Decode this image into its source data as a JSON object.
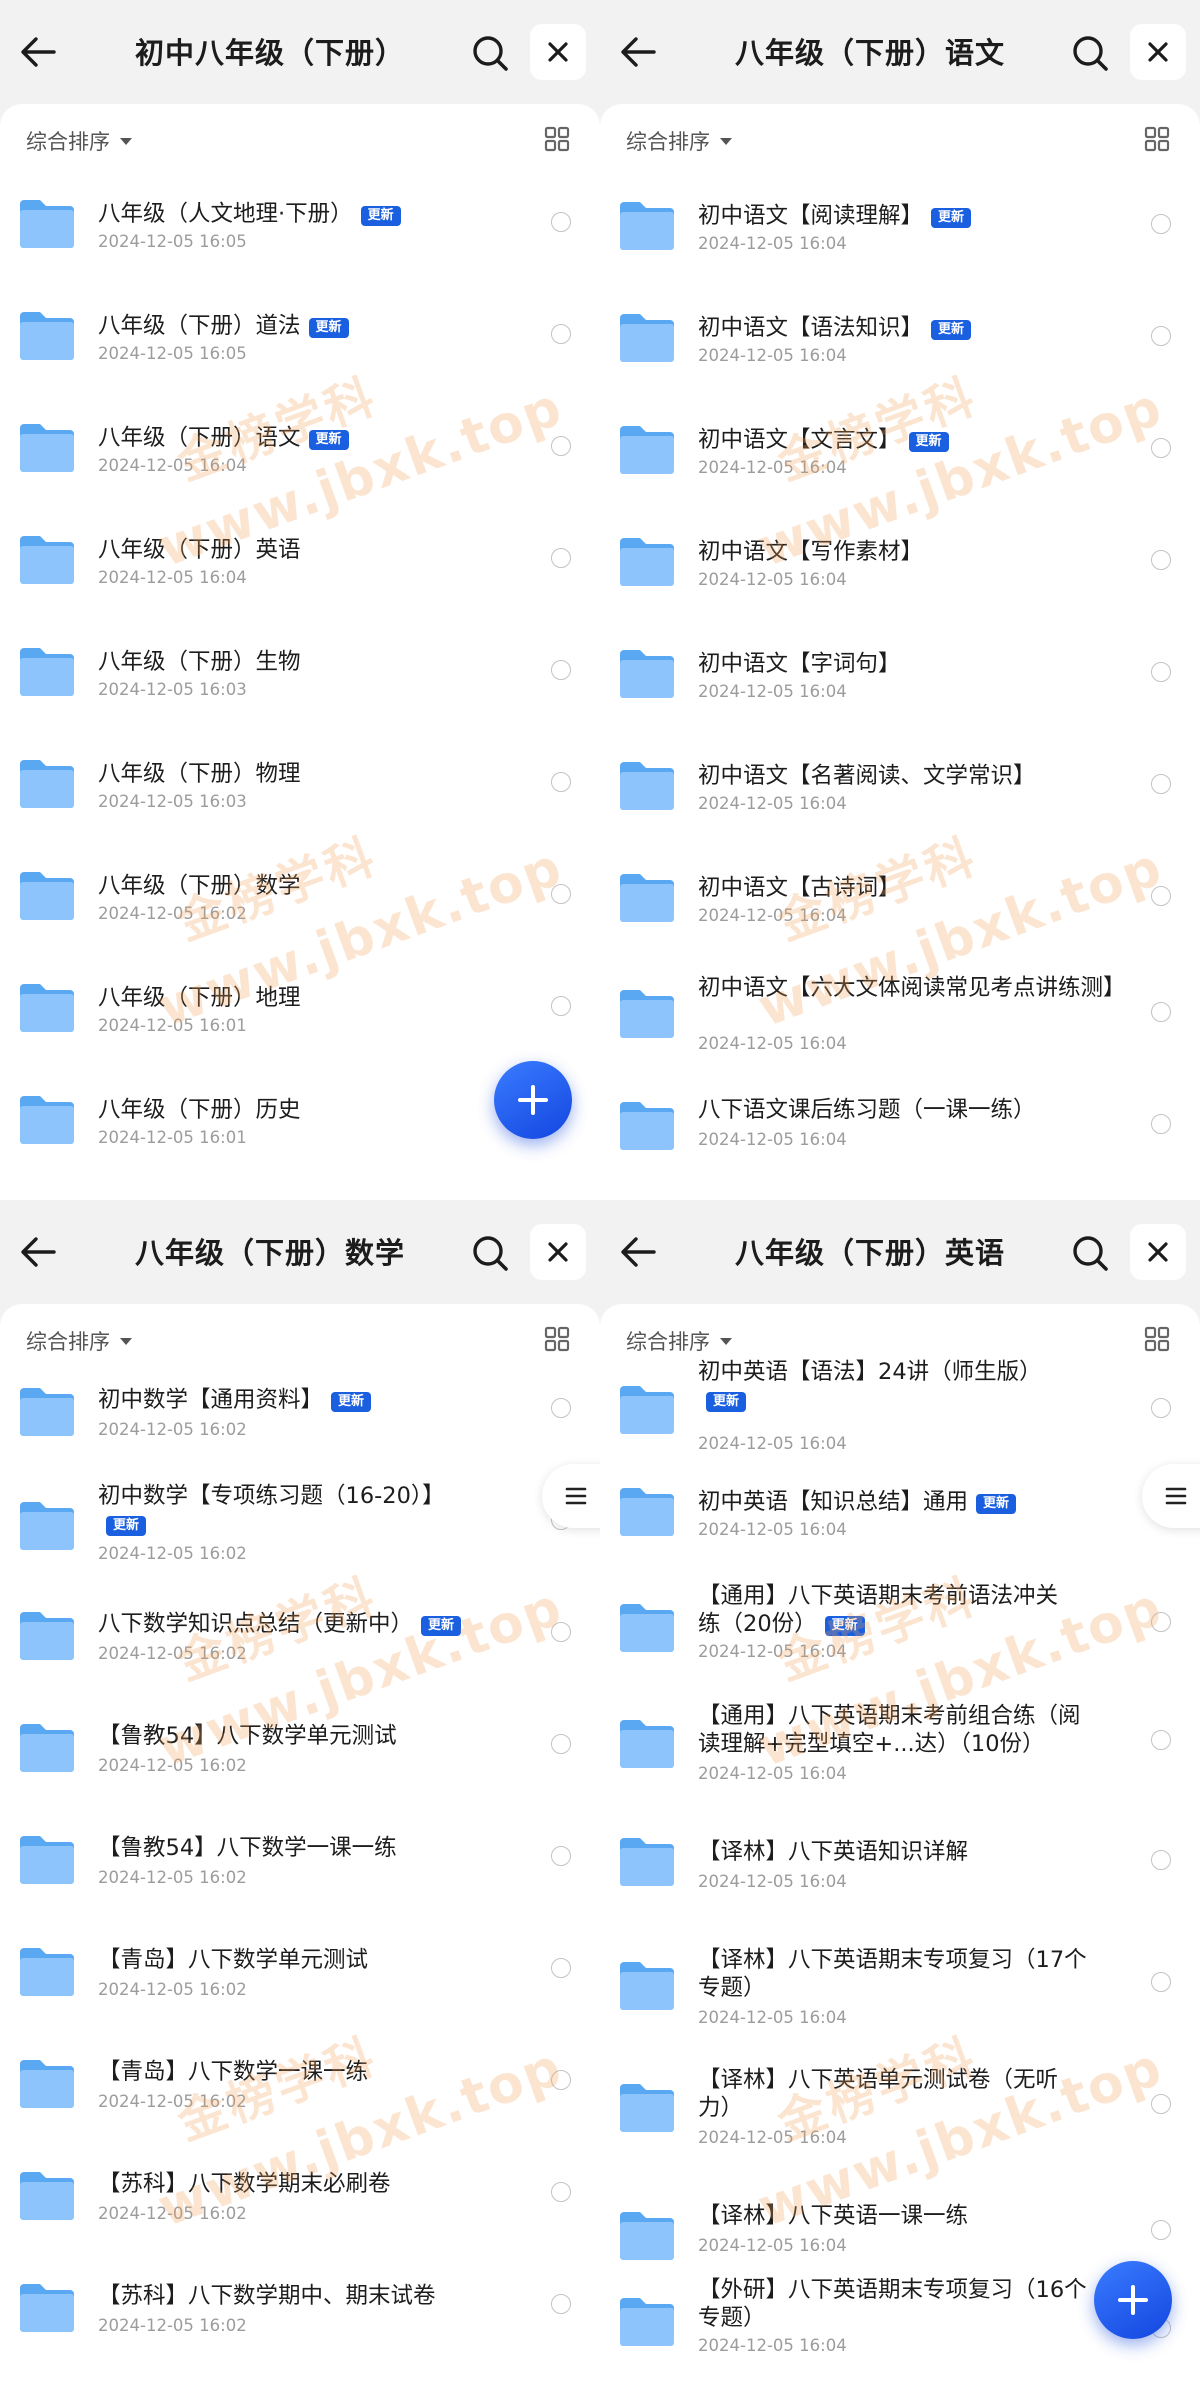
{
  "watermark": {
    "line1": "金榜学科",
    "line2": "www.jbxk.top"
  },
  "panels": [
    {
      "title": "初中八年级（下册）",
      "sort_label": "综合排序",
      "items": [
        {
          "name": "八年级（人文地理·下册）",
          "date": "2024-12-05 16:05",
          "badge": "更新"
        },
        {
          "name": "八年级（下册）道法",
          "date": "2024-12-05 16:05",
          "badge": "更新"
        },
        {
          "name": "八年级（下册）语文",
          "date": "2024-12-05 16:04",
          "badge": "更新"
        },
        {
          "name": "八年级（下册）英语",
          "date": "2024-12-05 16:04",
          "badge": ""
        },
        {
          "name": "八年级（下册）生物",
          "date": "2024-12-05 16:03",
          "badge": ""
        },
        {
          "name": "八年级（下册）物理",
          "date": "2024-12-05 16:03",
          "badge": ""
        },
        {
          "name": "八年级（下册）数学",
          "date": "2024-12-05 16:02",
          "badge": ""
        },
        {
          "name": "八年级（下册）地理",
          "date": "2024-12-05 16:01",
          "badge": ""
        },
        {
          "name": "八年级（下册）历史",
          "date": "2024-12-05 16:01",
          "badge": ""
        }
      ]
    },
    {
      "title": "八年级（下册）语文",
      "sort_label": "综合排序",
      "items": [
        {
          "name": "初中语文【阅读理解】",
          "date": "2024-12-05 16:04",
          "badge": "更新"
        },
        {
          "name": "初中语文【语法知识】",
          "date": "2024-12-05 16:04",
          "badge": "更新"
        },
        {
          "name": "初中语文【文言文】",
          "date": "2024-12-05 16:04",
          "badge": "更新"
        },
        {
          "name": "初中语文【写作素材】",
          "date": "2024-12-05 16:04",
          "badge": ""
        },
        {
          "name": "初中语文【字词句】",
          "date": "2024-12-05 16:04",
          "badge": ""
        },
        {
          "name": "初中语文【名著阅读、文学常识】",
          "date": "2024-12-05 16:04",
          "badge": ""
        },
        {
          "name": "初中语文【古诗词】",
          "date": "2024-12-05 16:04",
          "badge": ""
        },
        {
          "name": "初中语文【六大文体阅读常见考点讲练测】",
          "date": "2024-12-05 16:04",
          "badge": ""
        },
        {
          "name": "八下语文课后练习题（一课一练）",
          "date": "2024-12-05 16:04",
          "badge": ""
        }
      ]
    },
    {
      "title": "八年级（下册）数学",
      "sort_label": "综合排序",
      "items": [
        {
          "name": "初中数学【通用资料】",
          "date": "2024-12-05 16:02",
          "badge": "更新"
        },
        {
          "name": "初中数学【专项练习题（16-20）】",
          "date": "2024-12-05 16:02",
          "badge": "更新"
        },
        {
          "name": "八下数学知识点总结（更新中）",
          "date": "2024-12-05 16:02",
          "badge": "更新"
        },
        {
          "name": "【鲁教54】八下数学单元测试",
          "date": "2024-12-05 16:02",
          "badge": ""
        },
        {
          "name": "【鲁教54】八下数学一课一练",
          "date": "2024-12-05 16:02",
          "badge": ""
        },
        {
          "name": "【青岛】八下数学单元测试",
          "date": "2024-12-05 16:02",
          "badge": ""
        },
        {
          "name": "【青岛】八下数学一课一练",
          "date": "2024-12-05 16:02",
          "badge": ""
        },
        {
          "name": "【苏科】八下数学期末必刷卷",
          "date": "2024-12-05 16:02",
          "badge": ""
        },
        {
          "name": "【苏科】八下数学期中、期末试卷",
          "date": "2024-12-05 16:02",
          "badge": ""
        }
      ]
    },
    {
      "title": "八年级（下册）英语",
      "sort_label": "综合排序",
      "items": [
        {
          "name": "初中英语【语法】24讲（师生版）",
          "date": "2024-12-05 16:04",
          "badge": "更新"
        },
        {
          "name": "初中英语【知识总结】通用",
          "date": "2024-12-05 16:04",
          "badge": "更新"
        },
        {
          "name": "【通用】八下英语期末考前语法冲关练（20份）",
          "date": "2024-12-05 16:04",
          "badge": "更新"
        },
        {
          "name": "【通用】八下英语期末考前组合练（阅读理解+完型填空+...达）（10份）",
          "date": "2024-12-05 16:04",
          "badge": ""
        },
        {
          "name": "【译林】八下英语知识详解",
          "date": "2024-12-05 16:04",
          "badge": ""
        },
        {
          "name": "【译林】八下英语期末专项复习（17个专题）",
          "date": "2024-12-05 16:04",
          "badge": ""
        },
        {
          "name": "【译林】八下英语单元测试卷（无听力）",
          "date": "2024-12-05 16:04",
          "badge": ""
        },
        {
          "name": "【译林】八下英语一课一练",
          "date": "2024-12-05 16:04",
          "badge": ""
        },
        {
          "name": "【外研】八下英语期末专项复习（16个专题）",
          "date": "2024-12-05 16:04",
          "badge": ""
        }
      ]
    }
  ]
}
